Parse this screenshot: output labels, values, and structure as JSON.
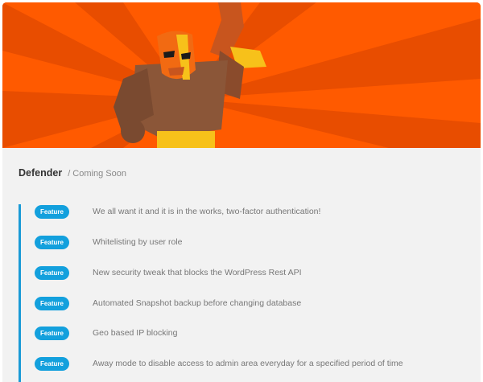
{
  "header": {
    "title": "Defender",
    "subtitle": "/ Coming Soon"
  },
  "features": [
    {
      "badge": "Feature",
      "text": "We all want it and it is in the works, two-factor authentication!"
    },
    {
      "badge": "Feature",
      "text": "Whitelisting by user role"
    },
    {
      "badge": "Feature",
      "text": "New security tweak that blocks the WordPress Rest API"
    },
    {
      "badge": "Feature",
      "text": "Automated Snapshot backup before changing database"
    },
    {
      "badge": "Feature",
      "text": "Geo based IP blocking"
    },
    {
      "badge": "Feature",
      "text": "Away mode to disable access to admin area everyday for a specified period of time"
    }
  ],
  "colors": {
    "accent": "#1a9ad6",
    "badge": "#13a0dd",
    "hero": "#ff5a00"
  }
}
